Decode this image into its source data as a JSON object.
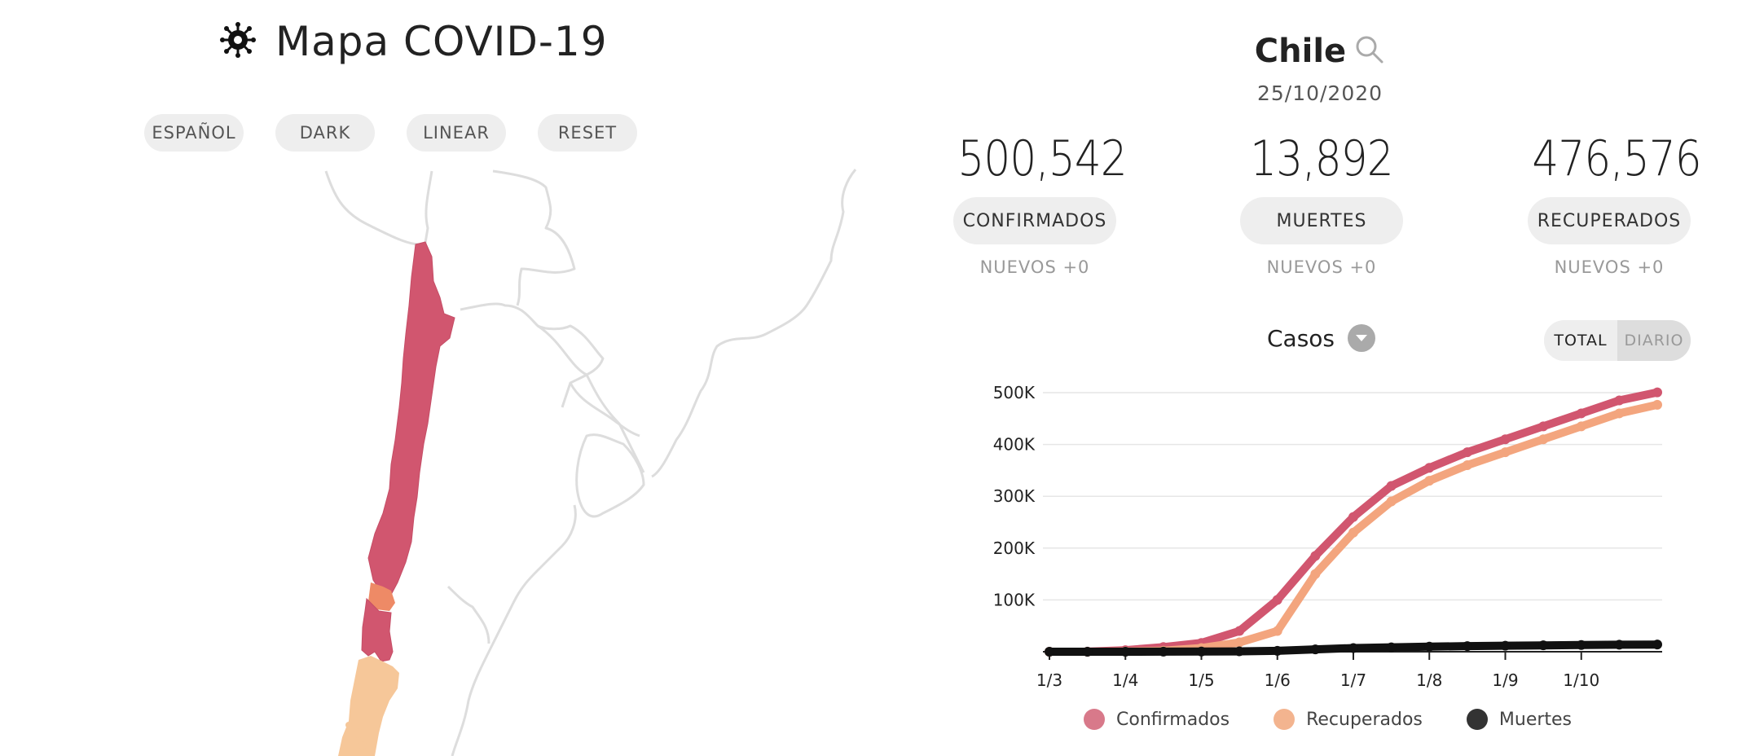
{
  "header": {
    "title": "Mapa COVID-19",
    "icon": "virus-icon"
  },
  "toolbar": {
    "language_label": "ESPAÑOL",
    "theme_label": "DARK",
    "scale_label": "LINEAR",
    "reset_label": "RESET"
  },
  "map": {
    "colors": {
      "outline": "#dddddd",
      "high": "#d1566f",
      "medium": "#ee8a66",
      "low": "#f6c799"
    }
  },
  "region": {
    "name": "Chile",
    "date": "25/10/2020",
    "search_icon": "search-icon"
  },
  "stats": {
    "confirmed": {
      "value": "500,542",
      "label": "CONFIRMADOS",
      "new": "NUEVOS +0"
    },
    "deaths": {
      "value": "13,892",
      "label": "MUERTES",
      "new": "NUEVOS +0"
    },
    "recovered": {
      "value": "476,576",
      "label": "RECUPERADOS",
      "new": "NUEVOS +0"
    }
  },
  "chart_controls": {
    "metric_label": "Casos",
    "dropdown_icon": "chevron-down-icon",
    "total_label": "TOTAL",
    "daily_label": "DIARIO"
  },
  "legend": {
    "confirmed": "Confirmados",
    "recovered": "Recuperados",
    "deaths": "Muertes"
  },
  "chart_data": {
    "type": "line",
    "x_ticks": [
      "1/3",
      "1/4",
      "1/5",
      "1/6",
      "1/7",
      "1/8",
      "1/9",
      "1/10"
    ],
    "y_ticks": [
      "100K",
      "200K",
      "300K",
      "400K",
      "500K"
    ],
    "ylim": [
      0,
      500000
    ],
    "grid": true,
    "x": [
      "1/3",
      "15/3",
      "1/4",
      "15/4",
      "1/5",
      "15/5",
      "1/6",
      "15/6",
      "1/7",
      "15/7",
      "1/8",
      "15/8",
      "1/9",
      "15/9",
      "1/10",
      "15/10",
      "25/10"
    ],
    "series": [
      {
        "name": "Confirmados",
        "color": "#d1566f",
        "values": [
          0,
          200,
          3000,
          9000,
          17000,
          40000,
          100000,
          185000,
          260000,
          320000,
          355000,
          385000,
          410000,
          435000,
          460000,
          485000,
          500542
        ]
      },
      {
        "name": "Recuperados",
        "color": "#f3a57e",
        "values": [
          0,
          0,
          300,
          2000,
          7000,
          18000,
          40000,
          150000,
          230000,
          290000,
          330000,
          360000,
          385000,
          410000,
          435000,
          460000,
          476576
        ]
      },
      {
        "name": "Muertes",
        "color": "#111111",
        "values": [
          0,
          0,
          30,
          200,
          300,
          700,
          1800,
          4500,
          7000,
          8500,
          9800,
          10800,
          11600,
          12300,
          13000,
          13600,
          13892
        ]
      }
    ],
    "legend_position": "bottom"
  }
}
